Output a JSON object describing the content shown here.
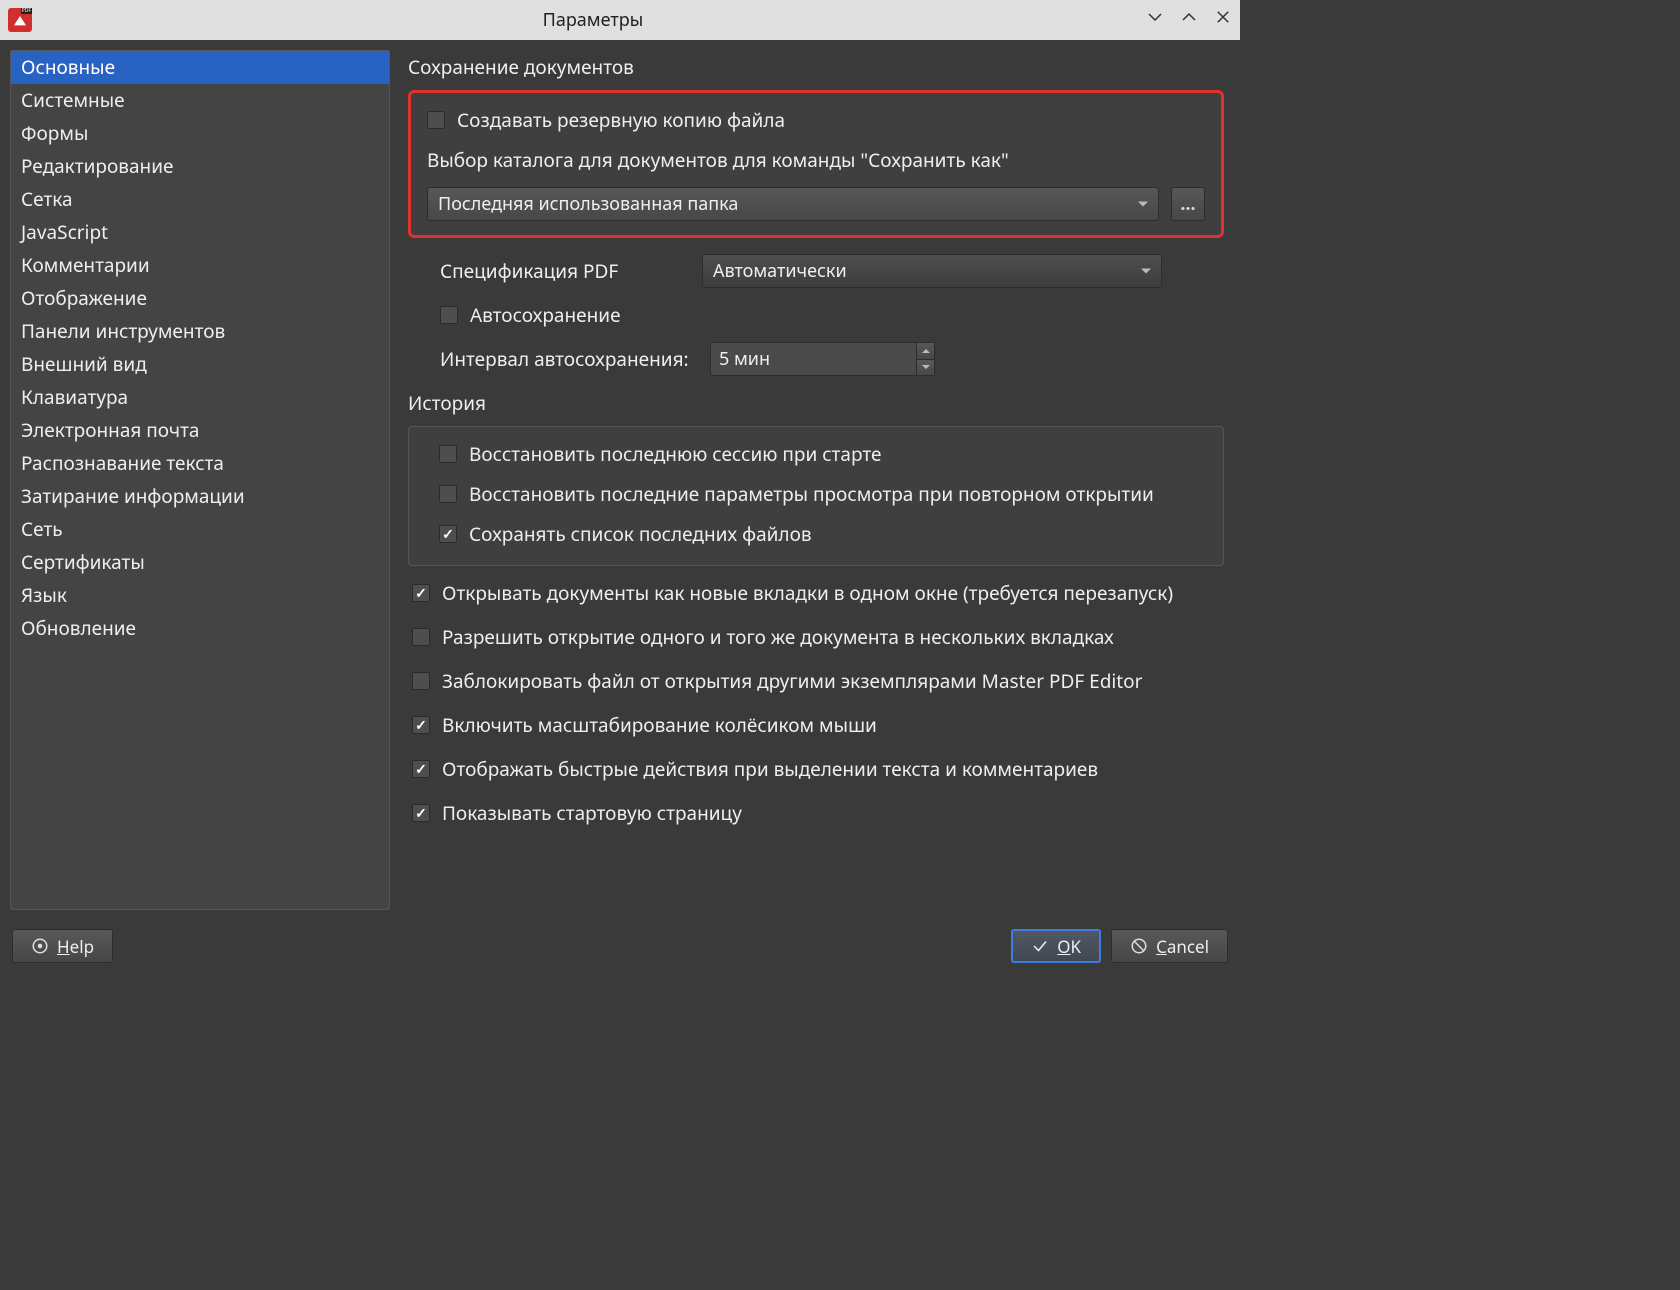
{
  "window": {
    "title": "Параметры"
  },
  "sidebar": {
    "items": [
      "Основные",
      "Системные",
      "Формы",
      "Редактирование",
      "Сетка",
      "JavaScript",
      "Комментарии",
      "Отображение",
      "Панели инструментов",
      "Внешний вид",
      "Клавиатура",
      "Электронная почта",
      "Распознавание текста",
      "Затирание информации",
      "Сеть",
      "Сертификаты",
      "Язык",
      "Обновление"
    ],
    "selected_index": 0
  },
  "sections": {
    "save": {
      "title": "Сохранение документов",
      "backup_label": "Создавать резервную копию файла",
      "folder_label": "Выбор каталога для документов для команды \"Сохранить как\"",
      "folder_combo": "Последняя использованная папка",
      "browse_label": "...",
      "pdf_spec_label": "Спецификация PDF",
      "pdf_spec_value": "Автоматически",
      "autosave_label": "Автосохранение",
      "interval_label": "Интервал автосохранения:",
      "interval_value": "5 мин"
    },
    "history": {
      "title": "История",
      "restore_session": "Восстановить последнюю сессию при старте",
      "restore_view": "Восстановить последние параметры просмотра при повторном открытии",
      "keep_recent": "Сохранять список последних файлов"
    },
    "options": [
      {
        "checked": true,
        "label": "Открывать документы как новые вкладки в одном окне (требуется перезапуск)"
      },
      {
        "checked": false,
        "label": "Разрешить открытие одного и того же документа в нескольких вкладках"
      },
      {
        "checked": false,
        "label": "Заблокировать файл от открытия другими экземплярами Master PDF Editor"
      },
      {
        "checked": true,
        "label": "Включить масштабирование колёсиком мыши"
      },
      {
        "checked": true,
        "label": "Отображать быстрые действия при выделении текста и комментариев"
      },
      {
        "checked": true,
        "label": "Показывать стартовую страницу"
      }
    ]
  },
  "buttons": {
    "help": "Help",
    "ok": "OK",
    "cancel": "Cancel"
  }
}
